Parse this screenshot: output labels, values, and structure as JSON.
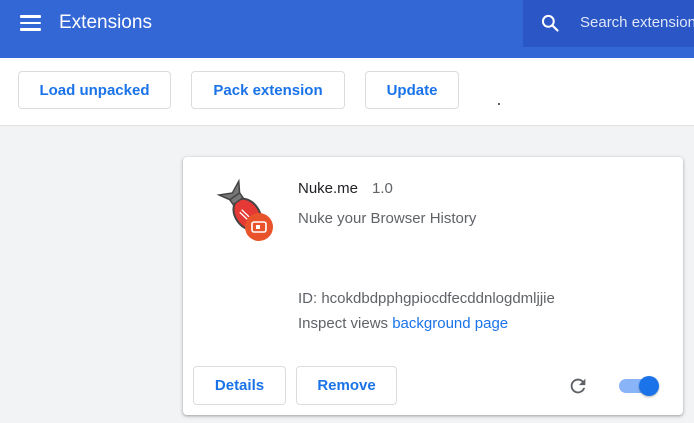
{
  "header": {
    "title": "Extensions",
    "search_placeholder": "Search extensions"
  },
  "toolbar": {
    "load_unpacked": "Load unpacked",
    "pack_extension": "Pack extension",
    "update": "Update"
  },
  "extension": {
    "name": "Nuke.me",
    "version": "1.0",
    "description": "Nuke your Browser History",
    "id_label": "ID: ",
    "id": "hcokdbdpphgpiocdfecddnlogdmljjie",
    "inspect_label": "Inspect views",
    "inspect_link": "background page",
    "details_label": "Details",
    "remove_label": "Remove",
    "enabled": true
  },
  "colors": {
    "header": "#3367d6",
    "accent": "#1a73e8",
    "badge": "#e8532b"
  },
  "icons": [
    "menu-icon",
    "search-icon",
    "bomb-icon",
    "reload-icon"
  ]
}
